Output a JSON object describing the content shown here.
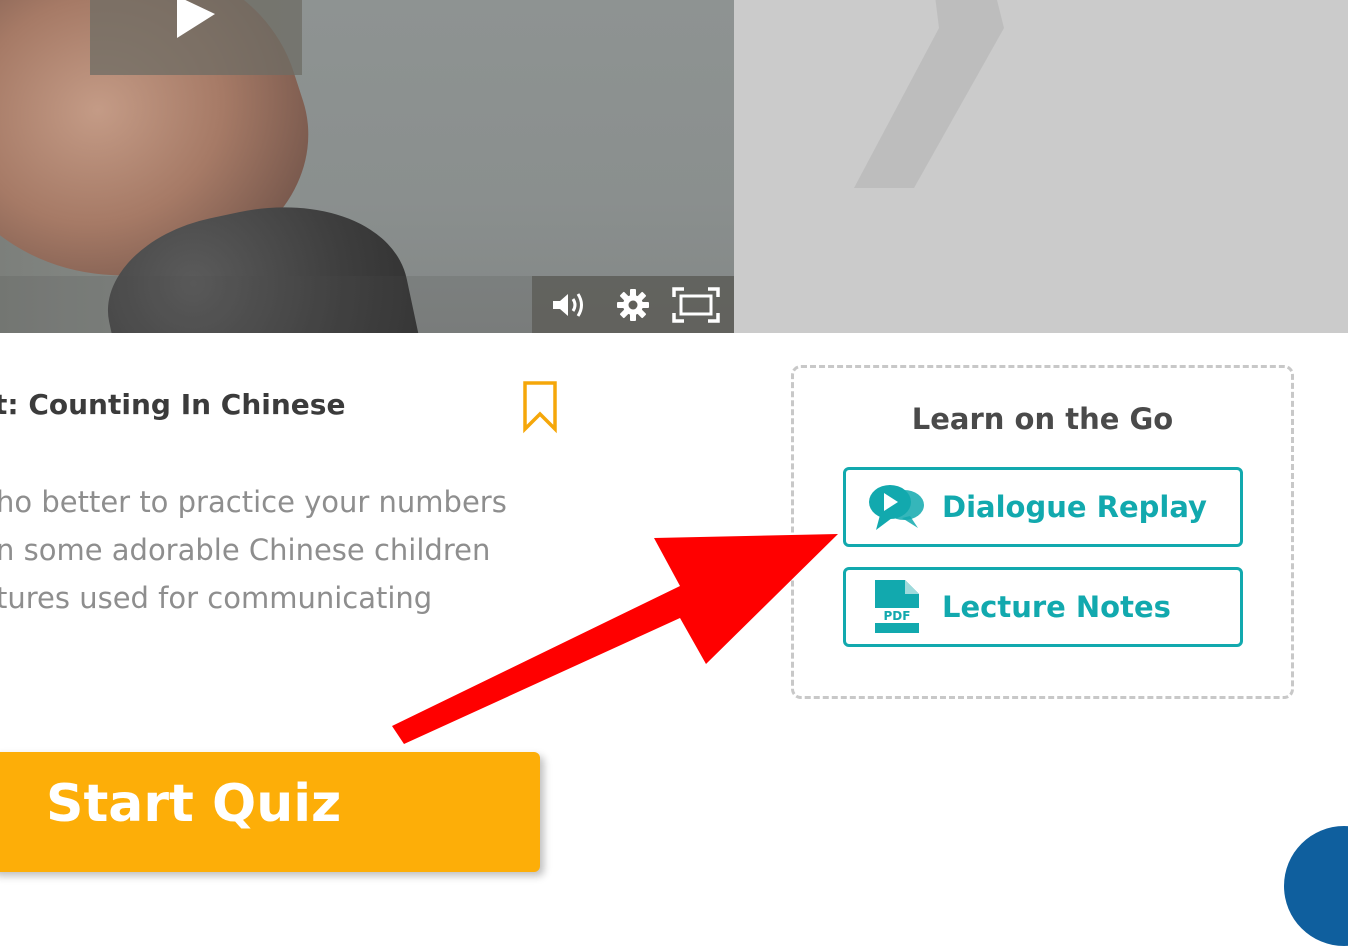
{
  "video": {
    "play_icon": "play-icon",
    "controls": {
      "volume_icon": "volume-icon",
      "settings_icon": "gear-icon",
      "fullscreen_icon": "fullscreen-icon"
    }
  },
  "next_panel": {
    "icon": "chevron-right-icon"
  },
  "lesson": {
    "title": "t: Counting In Chinese",
    "bookmark_icon": "bookmark-icon",
    "description_lines": [
      "ho better to practice your numbers",
      "n some adorable Chinese children",
      "tures used for communicating"
    ]
  },
  "learn_on_the_go": {
    "heading": "Learn on the Go",
    "buttons": {
      "dialogue_replay": {
        "label": "Dialogue Replay",
        "icon": "chat-play-icon"
      },
      "lecture_notes": {
        "label": "Lecture Notes",
        "icon": "pdf-icon",
        "icon_text": "PDF"
      }
    }
  },
  "quiz": {
    "label": "Start Quiz"
  },
  "colors": {
    "accent_teal": "#12a9ae",
    "quiz_orange": "#fdae08",
    "annotation_red": "#ff0000",
    "bookmark_orange": "#f5a70a"
  }
}
